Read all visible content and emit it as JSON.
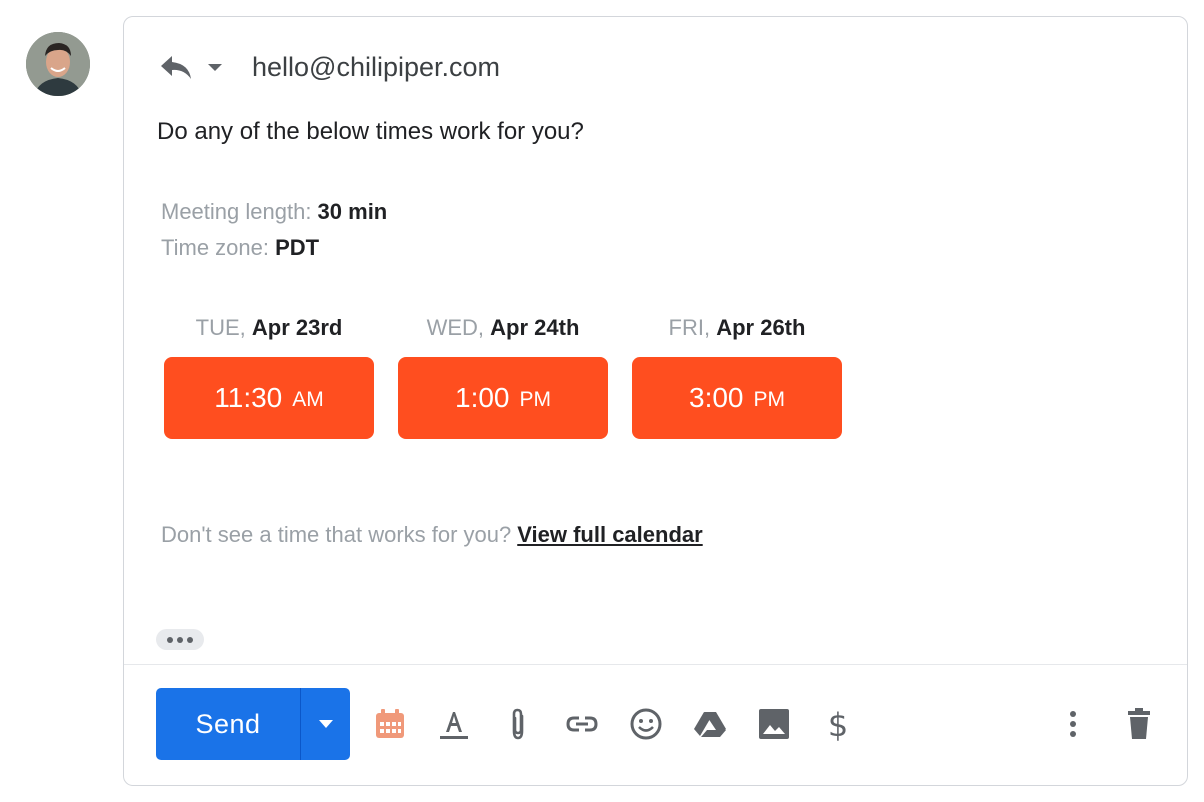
{
  "header": {
    "to_address": "hello@chilipiper.com",
    "reply_icon": "reply-icon",
    "reply_menu_icon": "caret-down-icon"
  },
  "body": {
    "question": "Do any of the below times work for you?",
    "meeting_length_label": "Meeting length: ",
    "meeting_length_value": "30 min",
    "time_zone_label": "Time zone: ",
    "time_zone_value": "PDT",
    "slots": [
      {
        "weekday": "TUE, ",
        "date": "Apr 23rd",
        "time": "11:30",
        "ampm": "AM"
      },
      {
        "weekday": "WED, ",
        "date": "Apr 24th",
        "time": "1:00",
        "ampm": "PM"
      },
      {
        "weekday": "FRI, ",
        "date": "Apr 26th",
        "time": "3:00",
        "ampm": "PM"
      }
    ],
    "no_time_text": "Don't see a time that works for you?",
    "view_calendar_link": "View full calendar"
  },
  "toolbar": {
    "send_label": "Send",
    "icons": [
      "calendar-icon",
      "text-format-icon",
      "attach-icon",
      "link-icon",
      "emoji-icon",
      "drive-icon",
      "image-icon",
      "dollar-icon",
      "more-options-icon",
      "trash-icon"
    ]
  },
  "colors": {
    "slot_button": "#ff4e1f",
    "send_button": "#1a73e8",
    "calendar_icon": "#f0997a",
    "muted_text": "#9aa0a6"
  }
}
